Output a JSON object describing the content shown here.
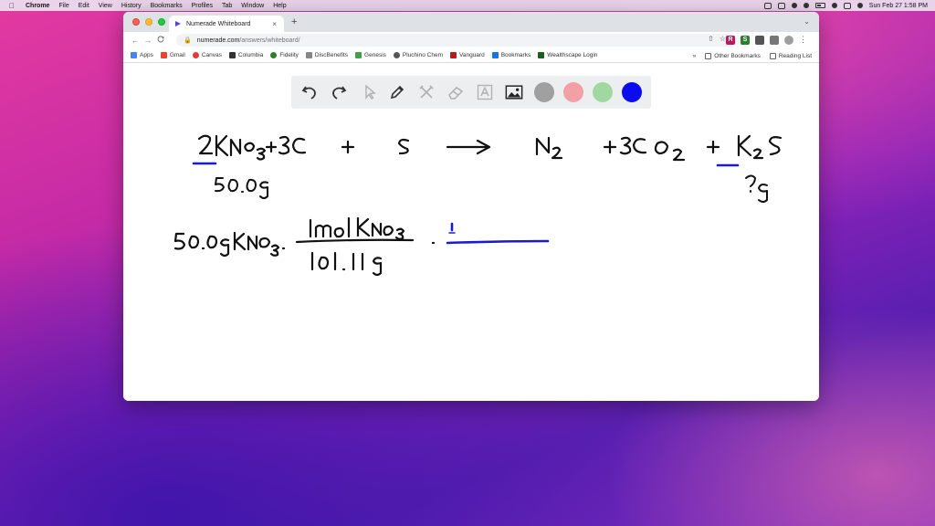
{
  "menubar": {
    "apple_icon": "apple-icon",
    "app_name": "Chrome",
    "menus": [
      "File",
      "Edit",
      "View",
      "History",
      "Bookmarks",
      "Profiles",
      "Tab",
      "Window",
      "Help"
    ],
    "clock": "Sun Feb 27  1:58 PM"
  },
  "browser": {
    "tab_title": "Numerade Whiteboard",
    "tab_close": "×",
    "new_tab": "+",
    "url_host": "numerade.com",
    "url_path": "/answers/whiteboard/",
    "back": "←",
    "forward": "→",
    "reload": "C",
    "extensions": [
      {
        "label": "R",
        "color": "#c2185b"
      },
      {
        "label": "S",
        "color": "#2e7d32"
      },
      {
        "label": "",
        "color": "#555555"
      },
      {
        "label": "",
        "color": "#777777"
      },
      {
        "label": "",
        "color": "#9e9e9e"
      }
    ],
    "menu_icon": "⋮"
  },
  "bookmarks": {
    "items": [
      {
        "label": "Apps",
        "color": "#4285f4"
      },
      {
        "label": "Gmail",
        "color": "#ea4335"
      },
      {
        "label": "Canvas",
        "color": "#e53935"
      },
      {
        "label": "Columbia",
        "color": "#333333"
      },
      {
        "label": "Fidelity",
        "color": "#2e7d32"
      },
      {
        "label": "DiscBenefits",
        "color": "#888888"
      },
      {
        "label": "Genesis",
        "color": "#43a047"
      },
      {
        "label": "Pluchino Chem",
        "color": "#555555"
      },
      {
        "label": "Vanguard",
        "color": "#b71c1c"
      },
      {
        "label": "Bookmarks",
        "color": "#1a73e8"
      },
      {
        "label": "Wealthscape Login",
        "color": "#1b5e20"
      }
    ],
    "overflow": "»",
    "other_bookmarks": "Other Bookmarks",
    "reading_list": "Reading List"
  },
  "whiteboard": {
    "tools": [
      "undo-icon",
      "redo-icon",
      "pointer-icon",
      "pen-icon",
      "tools-icon",
      "eraser-icon",
      "text-icon",
      "image-icon"
    ],
    "colors": [
      "#a0a0a0",
      "#f2a0a6",
      "#a0d8a0",
      "#0b0bf0"
    ],
    "selected_color": "#0b0bf0"
  },
  "handwriting": {
    "equation_line": "2KNO3 + 3C + S → N2 + 3CO2 + _K2S",
    "given_mass": "50.0g",
    "unknown_mass": "?g",
    "calc_start": "50.0g KNO3",
    "factor_numerator": "1mol KNO3",
    "factor_denominator": "101.11g"
  }
}
